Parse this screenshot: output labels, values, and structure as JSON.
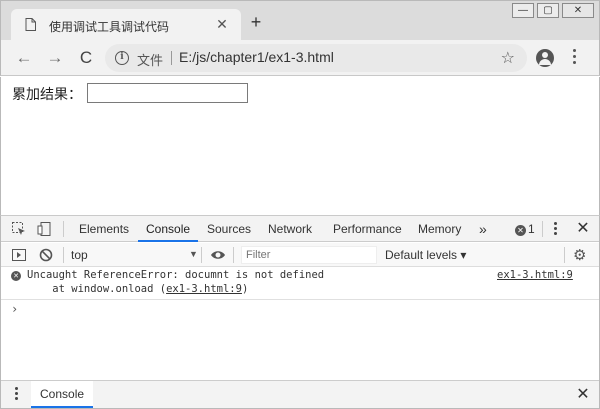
{
  "browser": {
    "tab_title": "使用调试工具调试代码",
    "tab_close_glyph": "✕",
    "new_tab_glyph": "+",
    "window_controls": {
      "minimize": "—",
      "maximize": "▢",
      "close": "✕"
    }
  },
  "toolbar": {
    "back_glyph": "←",
    "forward_glyph": "→",
    "reload_glyph": "C",
    "scheme_label": "文件",
    "url": "E:/js/chapter1/ex1-3.html",
    "star_glyph": "☆"
  },
  "page": {
    "label": "累加结果：",
    "result_value": ""
  },
  "devtools": {
    "tabs": [
      {
        "label": "Elements"
      },
      {
        "label": "Console",
        "active": true
      },
      {
        "label": "Sources"
      },
      {
        "label": "Network"
      },
      {
        "label": "Performance"
      },
      {
        "label": "Memory"
      }
    ],
    "more_tabs_glyph": "»",
    "error_count": "1",
    "close_glyph": "✕",
    "console_toolbar": {
      "context": "top",
      "context_arrow": "▼",
      "filter_placeholder": "Filter",
      "levels": "Default levels ▾",
      "gear_glyph": "⚙"
    },
    "messages": [
      {
        "level": "error",
        "text": "Uncaught ReferenceError: documnt is not defined",
        "stack_prefix": "    at window.onload (",
        "stack_link": "ex1-3.html:9",
        "stack_suffix": ")",
        "source": "ex1-3.html:9"
      }
    ],
    "prompt_glyph": "›",
    "drawer": {
      "tab_label": "Console",
      "close_glyph": "✕"
    }
  },
  "colors": {
    "accent": "#1a73e8",
    "tabstrip": "#dcdcdc",
    "toolbar": "#f2f2f2"
  }
}
